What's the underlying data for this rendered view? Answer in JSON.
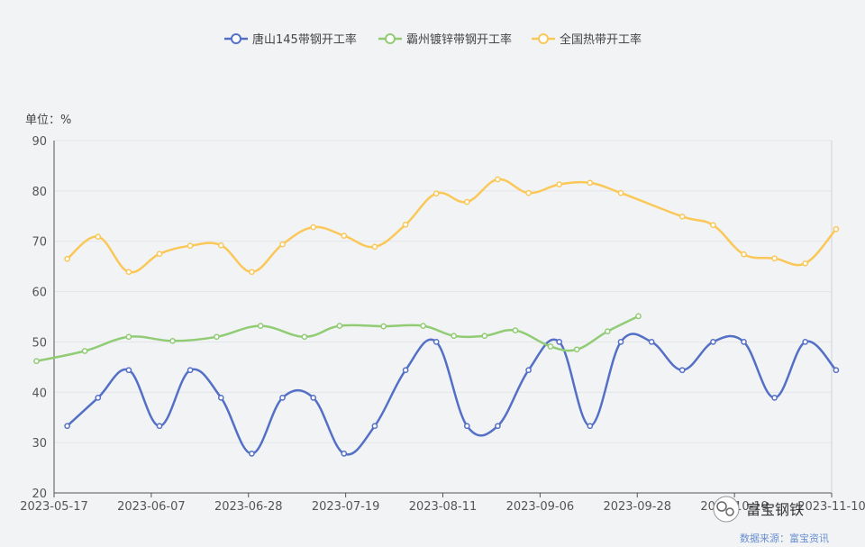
{
  "chart_data": {
    "type": "line",
    "ylabel": "单位：%",
    "ylim": [
      20,
      90
    ],
    "yticks": [
      20,
      30,
      40,
      50,
      60,
      70,
      80,
      90
    ],
    "xlim": [
      "2023-05-17",
      "2023-11-10"
    ],
    "xtick_labels": [
      "2023-05-17",
      "2023-06-07",
      "2023-06-28",
      "2023-07-19",
      "2023-08-11",
      "2023-09-06",
      "2023-09-28",
      "2023-10-19",
      "2023-11-10"
    ],
    "grid": true,
    "legend_position": "top-center",
    "series": [
      {
        "name": "唐山145带钢开工率",
        "color": "#5470c6",
        "points": [
          [
            "2023-05-20",
            33.3
          ],
          [
            "2023-05-27",
            38.9
          ],
          [
            "2023-06-03",
            44.4
          ],
          [
            "2023-06-10",
            33.3
          ],
          [
            "2023-06-17",
            44.4
          ],
          [
            "2023-06-24",
            38.9
          ],
          [
            "2023-07-01",
            27.8
          ],
          [
            "2023-07-08",
            38.9
          ],
          [
            "2023-07-15",
            38.9
          ],
          [
            "2023-07-22",
            27.8
          ],
          [
            "2023-07-29",
            33.3
          ],
          [
            "2023-08-05",
            44.4
          ],
          [
            "2023-08-12",
            50.0
          ],
          [
            "2023-08-19",
            33.3
          ],
          [
            "2023-08-26",
            33.3
          ],
          [
            "2023-09-02",
            44.4
          ],
          [
            "2023-09-09",
            50.0
          ],
          [
            "2023-09-16",
            33.3
          ],
          [
            "2023-09-23",
            50.0
          ],
          [
            "2023-09-30",
            50.0
          ],
          [
            "2023-10-07",
            44.4
          ],
          [
            "2023-10-14",
            50.0
          ],
          [
            "2023-10-21",
            50.0
          ],
          [
            "2023-10-28",
            38.9
          ],
          [
            "2023-11-04",
            50.0
          ],
          [
            "2023-11-11",
            44.4
          ]
        ]
      },
      {
        "name": "霸州镀锌带钢开工率",
        "color": "#91cc75",
        "points": [
          [
            "2023-05-13",
            46.2
          ],
          [
            "2023-05-24",
            48.2
          ],
          [
            "2023-06-03",
            51.0
          ],
          [
            "2023-06-13",
            50.2
          ],
          [
            "2023-06-23",
            51.0
          ],
          [
            "2023-07-03",
            53.2
          ],
          [
            "2023-07-13",
            51.0
          ],
          [
            "2023-07-21",
            53.2
          ],
          [
            "2023-07-31",
            53.1
          ],
          [
            "2023-08-09",
            53.2
          ],
          [
            "2023-08-16",
            51.2
          ],
          [
            "2023-08-23",
            51.2
          ],
          [
            "2023-08-30",
            52.3
          ],
          [
            "2023-09-07",
            49.1
          ],
          [
            "2023-09-13",
            48.5
          ],
          [
            "2023-09-20",
            52.1
          ],
          [
            "2023-09-27",
            55.1
          ]
        ]
      },
      {
        "name": "全国热带开工率",
        "color": "#fac858",
        "points": [
          [
            "2023-05-20",
            66.5
          ],
          [
            "2023-05-27",
            70.9
          ],
          [
            "2023-06-03",
            63.9
          ],
          [
            "2023-06-10",
            67.5
          ],
          [
            "2023-06-17",
            69.1
          ],
          [
            "2023-06-24",
            69.2
          ],
          [
            "2023-07-01",
            63.9
          ],
          [
            "2023-07-08",
            69.4
          ],
          [
            "2023-07-15",
            72.8
          ],
          [
            "2023-07-22",
            71.1
          ],
          [
            "2023-07-29",
            68.9
          ],
          [
            "2023-08-05",
            73.3
          ],
          [
            "2023-08-12",
            79.5
          ],
          [
            "2023-08-19",
            77.8
          ],
          [
            "2023-08-26",
            82.3
          ],
          [
            "2023-09-02",
            79.6
          ],
          [
            "2023-09-09",
            81.3
          ],
          [
            "2023-09-16",
            81.6
          ],
          [
            "2023-09-23",
            79.6
          ],
          [
            "2023-10-07",
            74.9
          ],
          [
            "2023-10-14",
            73.2
          ],
          [
            "2023-10-21",
            67.4
          ],
          [
            "2023-10-28",
            66.6
          ],
          [
            "2023-11-04",
            65.6
          ],
          [
            "2023-11-11",
            72.4
          ]
        ]
      }
    ]
  },
  "source_text": "数据来源：富宝资讯",
  "watermark_text": "富宝钢铁"
}
